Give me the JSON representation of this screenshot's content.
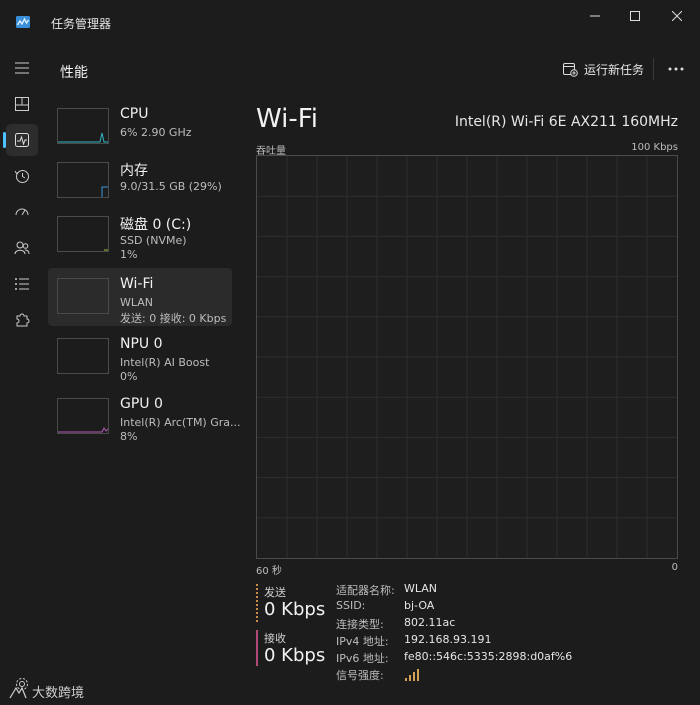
{
  "window": {
    "title": "任务管理器"
  },
  "header": {
    "title": "性能",
    "new_task_label": "运行新任务"
  },
  "devices": [
    {
      "name": "CPU",
      "line1": "6% 2.90 GHz",
      "line2": "",
      "color": "#2fb8c7"
    },
    {
      "name": "内存",
      "line1": "9.0/31.5 GB (29%)",
      "line2": "",
      "color": "#3a96dd"
    },
    {
      "name": "磁盘 0 (C:)",
      "line1": "SSD (NVMe)",
      "line2": "1%",
      "color": "#9ac23c"
    },
    {
      "name": "Wi-Fi",
      "line1": "WLAN",
      "line2": "发送: 0 接收: 0 Kbps",
      "color": "#a66e2a",
      "selected": true
    },
    {
      "name": "NPU 0",
      "line1": "Intel(R) AI Boost",
      "line2": "0%",
      "color": "#8a8a8a"
    },
    {
      "name": "GPU 0",
      "line1": "Intel(R) Arc(TM) Gra...",
      "line2": "8%",
      "color": "#b45ab8"
    }
  ],
  "detail": {
    "title": "Wi-Fi",
    "adapter": "Intel(R) Wi-Fi 6E AX211 160MHz",
    "graph": {
      "y_label": "吞吐量",
      "y_max": "100 Kbps",
      "x_left": "60 秒",
      "x_right": "0"
    },
    "send": {
      "label": "发送",
      "value": "0 Kbps",
      "color": "#c98a4a"
    },
    "receive": {
      "label": "接收",
      "value": "0 Kbps",
      "color": "#b04a7a"
    },
    "properties": [
      {
        "key": "适配器名称:",
        "value": "WLAN"
      },
      {
        "key": "SSID:",
        "value": "bj-OA"
      },
      {
        "key": "连接类型:",
        "value": "802.11ac"
      },
      {
        "key": "IPv4 地址:",
        "value": "192.168.93.191"
      },
      {
        "key": "IPv6 地址:",
        "value": "fe80::546c:5335:2898:d0af%6"
      },
      {
        "key": "信号强度:",
        "value": ""
      }
    ],
    "signal_bars_filled": 4
  },
  "watermark": "大数跨境",
  "colors": {
    "accent": "#4cc2ff",
    "signal": "#d4a054"
  }
}
